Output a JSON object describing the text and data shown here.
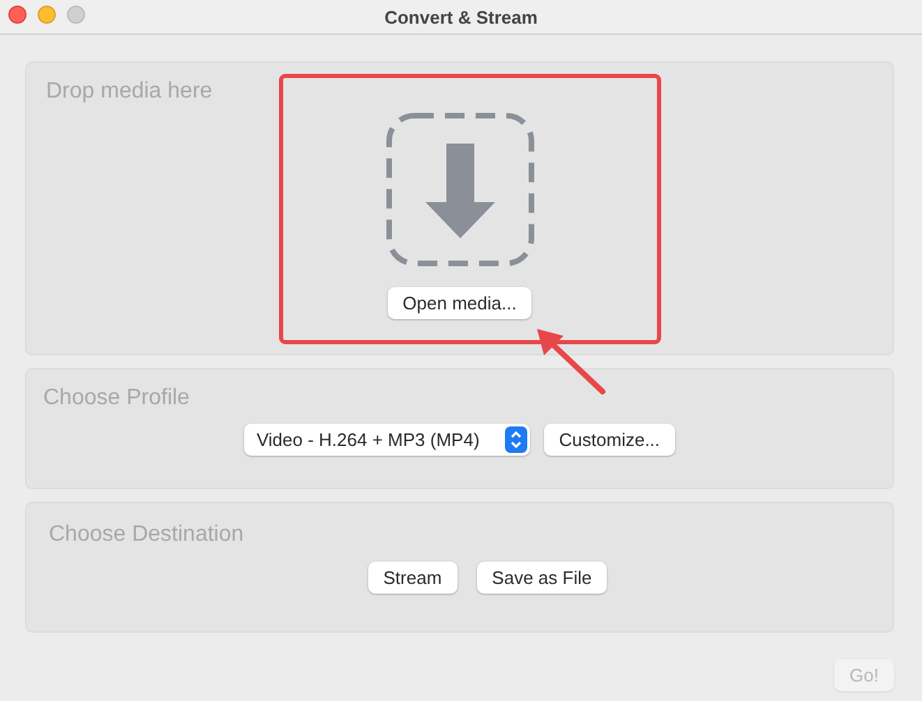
{
  "window": {
    "title": "Convert & Stream"
  },
  "drop_panel": {
    "title": "Drop media here",
    "button": "Open media..."
  },
  "profile_panel": {
    "title": "Choose Profile",
    "profile_select": "Video - H.264 + MP3 (MP4)",
    "button": "Customize..."
  },
  "destination_panel": {
    "title": "Choose Destination",
    "buttons": [
      "Stream",
      "Save as File"
    ]
  },
  "go_button": {
    "label": "Go!",
    "disabled": true
  }
}
